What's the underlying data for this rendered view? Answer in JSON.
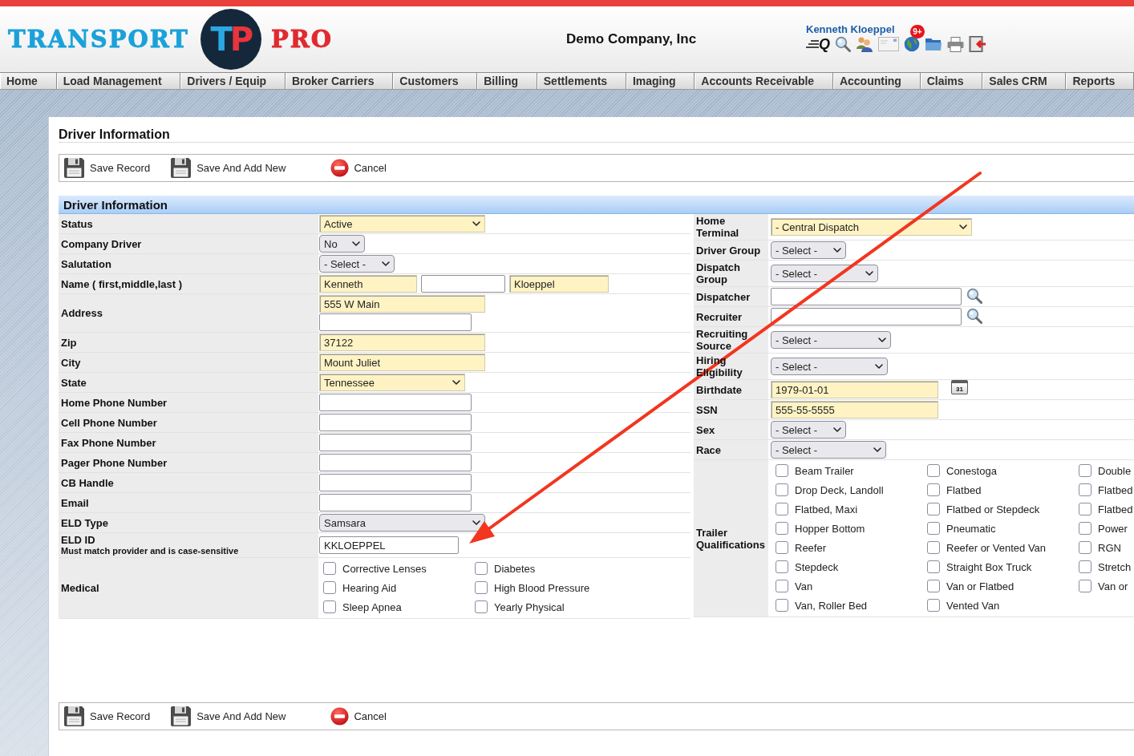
{
  "header": {
    "logo": {
      "word": "TRANSPORT",
      "monogram": "TP",
      "suffix": "PRO"
    },
    "company": "Demo Company, Inc",
    "user": "Kenneth Kloeppel",
    "tools": [
      {
        "kind": "quick_search",
        "label": "Q"
      },
      {
        "kind": "search"
      },
      {
        "kind": "contacts"
      },
      {
        "kind": "mail"
      },
      {
        "kind": "globe",
        "badge": "9+"
      },
      {
        "kind": "folder"
      },
      {
        "kind": "print"
      },
      {
        "kind": "exit"
      }
    ]
  },
  "nav": [
    "Home",
    "Load Management",
    "Drivers / Equip",
    "Broker Carriers",
    "Customers",
    "Billing",
    "Settlements",
    "Imaging",
    "Accounts Receivable",
    "Accounting",
    "Claims",
    "Sales CRM",
    "Reports"
  ],
  "page_title": "Driver Information",
  "toolbar_top": [
    {
      "kind": "save",
      "label": "Save Record"
    },
    {
      "kind": "save",
      "label": "Save And Add New"
    },
    {
      "kind": "cancel",
      "label": "Cancel"
    }
  ],
  "form": {
    "title": "Driver Information",
    "left_rows": [
      {
        "label": "Status",
        "lines": [
          [
            {
              "kind": "select",
              "value": "Active",
              "highlighted": true
            }
          ]
        ]
      },
      {
        "label": "Company Driver",
        "lines": [
          [
            {
              "kind": "select",
              "value": "No",
              "highlighted": false
            }
          ]
        ]
      },
      {
        "label": "Salutation",
        "lines": [
          [
            {
              "kind": "select",
              "value": "- Select -",
              "highlighted": false
            }
          ]
        ]
      },
      {
        "label": "Name ( first,middle,last )",
        "lines": [
          [
            {
              "kind": "input",
              "value": "Kenneth",
              "highlighted": true
            },
            {
              "kind": "input",
              "highlighted": false
            },
            {
              "kind": "input",
              "value": "Kloeppel",
              "highlighted": true
            }
          ]
        ]
      },
      {
        "label": "Address",
        "lines": [
          [
            {
              "kind": "input",
              "value": "555 W Main",
              "highlighted": true
            }
          ],
          [
            {
              "kind": "input",
              "highlighted": false
            }
          ]
        ]
      },
      {
        "label": "Zip",
        "lines": [
          [
            {
              "kind": "input",
              "value": "37122",
              "highlighted": true
            }
          ]
        ]
      },
      {
        "label": "City",
        "lines": [
          [
            {
              "kind": "input",
              "value": "Mount Juliet",
              "highlighted": true
            }
          ]
        ]
      },
      {
        "label": "State",
        "lines": [
          [
            {
              "kind": "select",
              "value": "Tennessee",
              "highlighted": true
            }
          ]
        ]
      },
      {
        "label": "Home Phone Number",
        "lines": [
          [
            {
              "kind": "input",
              "highlighted": false
            }
          ]
        ]
      },
      {
        "label": "Cell Phone Number",
        "lines": [
          [
            {
              "kind": "input",
              "highlighted": false
            }
          ]
        ]
      },
      {
        "label": "Fax Phone Number",
        "lines": [
          [
            {
              "kind": "input",
              "highlighted": false
            }
          ]
        ]
      },
      {
        "label": "Pager Phone Number",
        "lines": [
          [
            {
              "kind": "input",
              "highlighted": false
            }
          ]
        ]
      },
      {
        "label": "CB Handle",
        "lines": [
          [
            {
              "kind": "input",
              "highlighted": false
            }
          ]
        ]
      },
      {
        "label": "Email",
        "lines": [
          [
            {
              "kind": "input",
              "highlighted": false
            }
          ]
        ]
      },
      {
        "label": "ELD Type",
        "lines": [
          [
            {
              "kind": "select",
              "value": "Samsara",
              "highlighted": false
            }
          ]
        ]
      },
      {
        "label": "ELD ID",
        "note": "Must match provider and is case-sensitive",
        "lines": [
          [
            {
              "kind": "input",
              "value": "KKLOEPPEL",
              "highlighted": false
            }
          ]
        ]
      },
      {
        "label": "Medical",
        "checkboxes": [
          {
            "label": "Corrective Lenses",
            "checked": false
          },
          {
            "label": "Diabetes",
            "checked": false
          },
          {
            "label": "Hearing Aid",
            "checked": false
          },
          {
            "label": "High Blood Pressure",
            "checked": false
          },
          {
            "label": "Sleep Apnea",
            "checked": false
          },
          {
            "label": "Yearly Physical",
            "checked": false
          }
        ]
      }
    ],
    "right_rows": [
      {
        "label": "Home Terminal",
        "lines": [
          [
            {
              "kind": "select",
              "value": "- Central Dispatch",
              "highlighted": true
            }
          ]
        ]
      },
      {
        "label": "Driver Group",
        "lines": [
          [
            {
              "kind": "select",
              "value": "- Select -",
              "highlighted": false
            }
          ]
        ]
      },
      {
        "label": "Dispatch Group",
        "lines": [
          [
            {
              "kind": "select",
              "value": "- Select -",
              "highlighted": false
            }
          ]
        ]
      },
      {
        "label": "Dispatcher",
        "lines": [
          [
            {
              "kind": "lookup",
              "highlighted": false
            }
          ]
        ]
      },
      {
        "label": "Recruiter",
        "lines": [
          [
            {
              "kind": "lookup",
              "highlighted": false
            }
          ]
        ]
      },
      {
        "label": "Recruiting Source",
        "lines": [
          [
            {
              "kind": "select",
              "value": "- Select -",
              "highlighted": false
            }
          ]
        ]
      },
      {
        "label": "Hiring Eligibility",
        "lines": [
          [
            {
              "kind": "select",
              "value": "- Select -",
              "highlighted": false
            }
          ]
        ]
      },
      {
        "label": "Birthdate",
        "lines": [
          [
            {
              "kind": "date",
              "value": "1979-01-01",
              "highlighted": true,
              "calendar": "31"
            }
          ]
        ]
      },
      {
        "label": "SSN",
        "lines": [
          [
            {
              "kind": "input",
              "value": "555-55-5555",
              "highlighted": true
            }
          ]
        ]
      },
      {
        "label": "Sex",
        "lines": [
          [
            {
              "kind": "select",
              "value": "- Select -",
              "highlighted": false
            }
          ]
        ]
      },
      {
        "label": "Race",
        "lines": [
          [
            {
              "kind": "select",
              "value": "- Select -",
              "highlighted": false
            }
          ]
        ]
      },
      {
        "label": "Trailer Qualifications",
        "checkboxes": [
          {
            "label": "Beam Trailer",
            "checked": false
          },
          {
            "label": "Conestoga",
            "checked": false
          },
          {
            "label": "Double",
            "checked": false
          },
          {
            "label": "Drop Deck, Landoll",
            "checked": false
          },
          {
            "label": "Flatbed",
            "checked": false
          },
          {
            "label": "Flatbed",
            "checked": false
          },
          {
            "label": "Flatbed, Maxi",
            "checked": false
          },
          {
            "label": "Flatbed or Stepdeck",
            "checked": false
          },
          {
            "label": "Flatbed",
            "checked": false
          },
          {
            "label": "Hopper Bottom",
            "checked": false
          },
          {
            "label": "Pneumatic",
            "checked": false
          },
          {
            "label": "Power",
            "checked": false
          },
          {
            "label": "Reefer",
            "checked": false
          },
          {
            "label": "Reefer or Vented Van",
            "checked": false
          },
          {
            "label": "RGN",
            "checked": false
          },
          {
            "label": "Stepdeck",
            "checked": false
          },
          {
            "label": "Straight Box Truck",
            "checked": false
          },
          {
            "label": "Stretch",
            "checked": false
          },
          {
            "label": "Van",
            "checked": false
          },
          {
            "label": "Van or Flatbed",
            "checked": false
          },
          {
            "label": "Van or",
            "checked": false
          },
          {
            "label": "Van, Roller Bed",
            "checked": false
          },
          {
            "label": "Vented Van",
            "checked": false
          }
        ]
      }
    ]
  },
  "toolbar_bottom": [
    {
      "kind": "save",
      "label": "Save Record"
    },
    {
      "kind": "save",
      "label": "Save And Add New"
    },
    {
      "kind": "cancel",
      "label": "Cancel"
    }
  ],
  "annotation": {
    "kind": "arrow"
  }
}
